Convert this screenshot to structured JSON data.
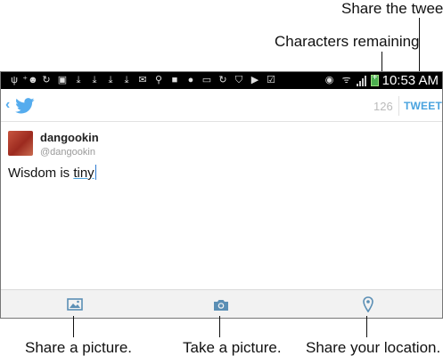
{
  "callouts": {
    "share_tweet": "Share the tweet.",
    "characters_remaining": "Characters remaining",
    "share_picture": "Share a picture.",
    "take_picture": "Take a picture.",
    "share_location": "Share your location."
  },
  "status_bar": {
    "time": "10:53 AM",
    "left_icons": [
      "usb-icon",
      "person-add-icon",
      "sync-icon",
      "device-icon",
      "download-icon",
      "download-icon",
      "download-icon",
      "download-icon",
      "gmail-icon",
      "person-icon",
      "facebook-icon",
      "hangouts-icon",
      "voicemail-icon",
      "sync-icon",
      "shield-icon",
      "play-store-icon",
      "checklist-icon"
    ],
    "right_icons": [
      "eye-icon",
      "wifi-icon",
      "signal-icon",
      "battery-icon"
    ]
  },
  "action_bar": {
    "characters_remaining": "126",
    "tweet_button": "TWEET"
  },
  "compose": {
    "display_name": "dangookin",
    "handle": "@dangookin",
    "text_before": "Wisdom is ",
    "text_underlined": "tiny"
  },
  "toolbar": {
    "buttons": [
      "picture-icon",
      "camera-icon",
      "location-pin-icon"
    ]
  },
  "colors": {
    "twitter_blue": "#55acee",
    "tweet_button": "#4aa3df",
    "status_bar": "#000000",
    "toolbar_bg": "#f2f2f2"
  }
}
